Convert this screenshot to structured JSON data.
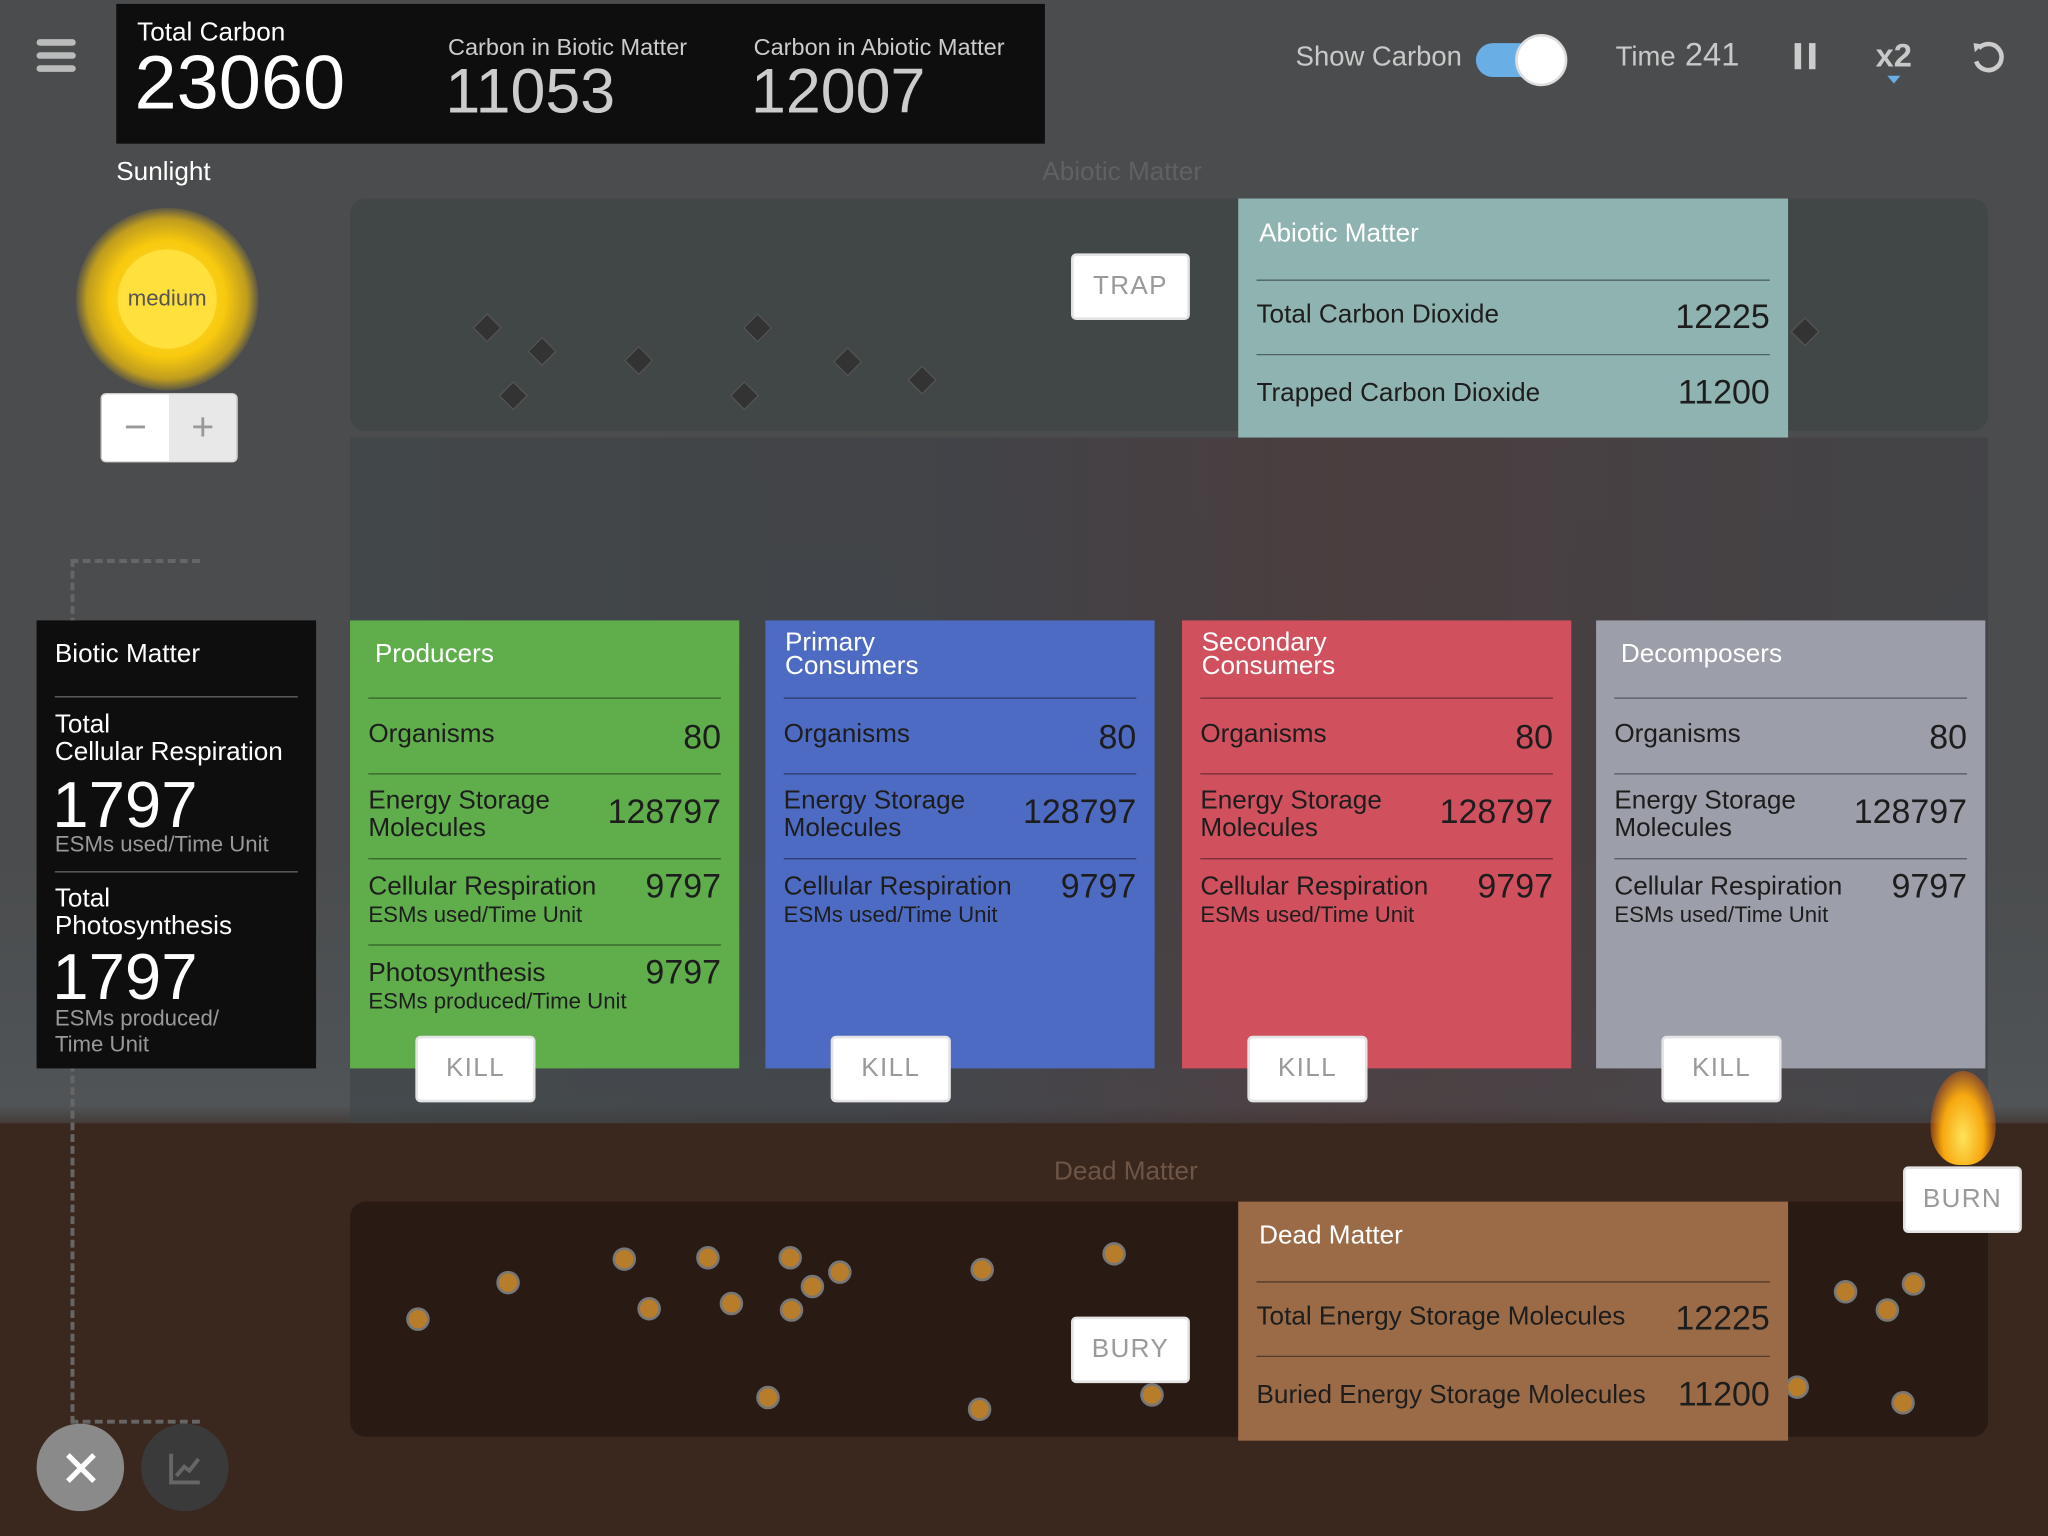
{
  "header": {
    "total_carbon_label": "Total Carbon",
    "total_carbon": "23060",
    "biotic_label": "Carbon in Biotic Matter",
    "biotic": "11053",
    "abiotic_label": "Carbon in Abiotic Matter",
    "abiotic": "12007"
  },
  "controls": {
    "show_carbon_label": "Show Carbon",
    "show_carbon_on": true,
    "time_label": "Time",
    "time_value": "241",
    "speed": "x2"
  },
  "sunlight": {
    "label": "Sunlight",
    "level": "medium",
    "minus": "−",
    "plus": "+"
  },
  "abiotic_area_label": "Abiotic Matter",
  "dead_area_label": "Dead Matter",
  "buttons": {
    "trap": "TRAP",
    "bury": "BURY",
    "burn": "BURN",
    "kill": "KILL"
  },
  "abiotic_panel": {
    "title": "Abiotic Matter",
    "rows": [
      {
        "label": "Total Carbon Dioxide",
        "value": "12225"
      },
      {
        "label": "Trapped Carbon Dioxide",
        "value": "11200"
      }
    ]
  },
  "dead_panel": {
    "title": "Dead Matter",
    "rows": [
      {
        "label": "Total Energy Storage Molecules",
        "value": "12225"
      },
      {
        "label": "Buried Energy Storage Molecules",
        "value": "11200"
      }
    ]
  },
  "biotic_panel": {
    "title": "Biotic Matter",
    "resp_title_1": "Total",
    "resp_title_2": "Cellular Respiration",
    "resp_value": "1797",
    "resp_unit": "ESMs used/Time Unit",
    "photo_title_1": "Total",
    "photo_title_2": "Photosynthesis",
    "photo_value": "1797",
    "photo_unit_1": "ESMs produced/",
    "photo_unit_2": "Time Unit"
  },
  "trophic": [
    {
      "title_1": "Producers",
      "title_2": "",
      "color": "#5fae4b",
      "organisms_label": "Organisms",
      "organisms": "80",
      "esm_label_1": "Energy Storage",
      "esm_label_2": "Molecules",
      "esm": "128797",
      "resp_label": "Cellular Respiration",
      "resp_unit": "ESMs used/Time Unit",
      "resp": "9797",
      "photo_label": "Photosynthesis",
      "photo_unit": "ESMs produced/Time Unit",
      "photo": "9797"
    },
    {
      "title_1": "Primary",
      "title_2": "Consumers",
      "color": "#4e6bc3",
      "organisms_label": "Organisms",
      "organisms": "80",
      "esm_label_1": "Energy Storage",
      "esm_label_2": "Molecules",
      "esm": "128797",
      "resp_label": "Cellular Respiration",
      "resp_unit": "ESMs used/Time Unit",
      "resp": "9797"
    },
    {
      "title_1": "Secondary",
      "title_2": "Consumers",
      "color": "#d0505e",
      "organisms_label": "Organisms",
      "organisms": "80",
      "esm_label_1": "Energy Storage",
      "esm_label_2": "Molecules",
      "esm": "128797",
      "resp_label": "Cellular Respiration",
      "resp_unit": "ESMs used/Time Unit",
      "resp": "9797"
    },
    {
      "title_1": "Decomposers",
      "title_2": "",
      "color": "#9c9ea9",
      "organisms_label": "Organisms",
      "organisms": "80",
      "esm_label_1": "Energy Storage",
      "esm_label_2": "Molecules",
      "esm": "128797",
      "resp_label": "Cellular Respiration",
      "resp_unit": "ESMs used/Time Unit",
      "resp": "9797"
    }
  ],
  "colors": {
    "abiotic_panel": "#8fb3b0",
    "dead_panel": "#9b6b48",
    "toggle_on": "#6aaee6",
    "biotic_panel": "#0e0e0e"
  },
  "icons": {
    "menu": "hamburger-icon",
    "pause": "pause-icon",
    "reset": "reset-icon",
    "close": "close-icon",
    "chart": "chart-icon",
    "flame": "flame-icon"
  }
}
